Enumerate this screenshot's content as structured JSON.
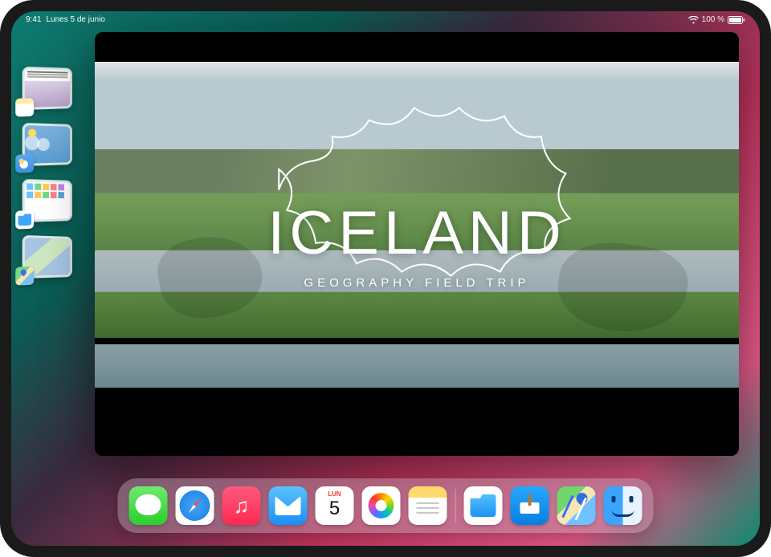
{
  "status": {
    "time": "9:41",
    "date": "Lunes 5 de junio",
    "battery_pct": "100 %"
  },
  "stage_manager": {
    "tiles": [
      {
        "app": "Notes"
      },
      {
        "app": "Weather"
      },
      {
        "app": "Files"
      },
      {
        "app": "Maps"
      }
    ]
  },
  "presentation": {
    "title": "ICELAND",
    "subtitle": "GEOGRAPHY FIELD TRIP"
  },
  "calendar": {
    "weekday": "LUN",
    "day": "5"
  },
  "dock": {
    "apps_left": [
      "Messages",
      "Safari",
      "Music",
      "Mail",
      "Calendar",
      "Photos",
      "Notes"
    ],
    "apps_right": [
      "Files",
      "Keynote",
      "Maps",
      "Finder"
    ]
  }
}
